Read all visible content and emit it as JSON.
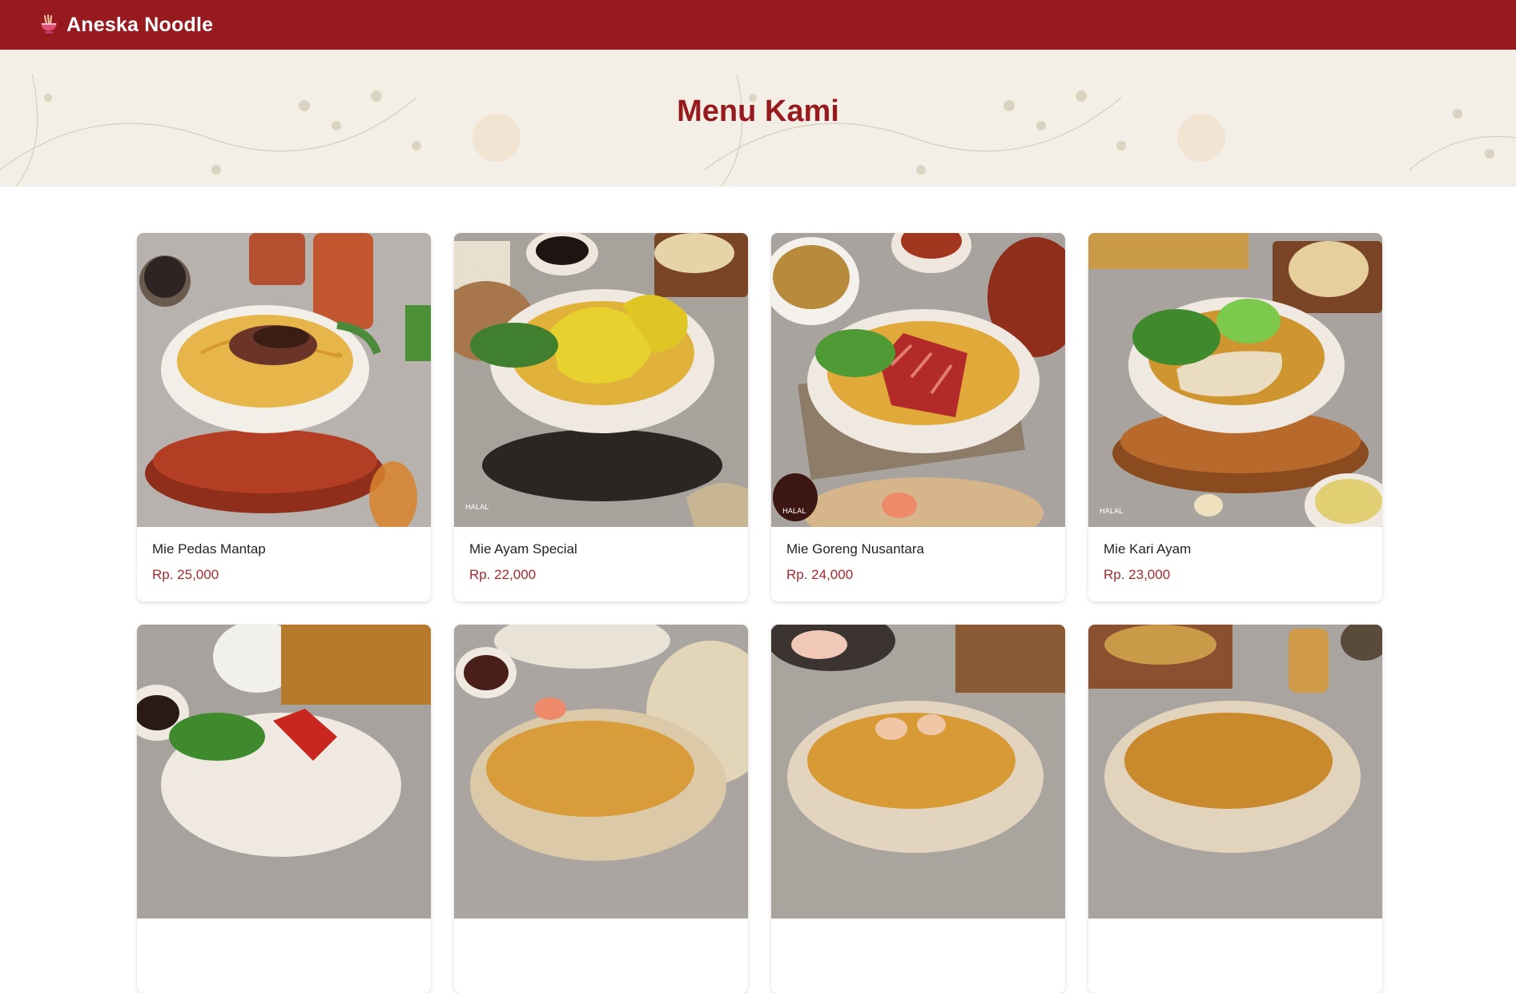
{
  "navbar": {
    "brand": "Aneska Noodle",
    "brand_icon": "noodle-bowl-icon",
    "background": "#971a1f"
  },
  "hero": {
    "title": "Menu Kami",
    "title_color": "#971a1f"
  },
  "menu": {
    "price_color": "#a52a2f",
    "items": [
      {
        "name": "Mie Pedas Mantap",
        "price": "Rp. 25,000"
      },
      {
        "name": "Mie Ayam Special",
        "price": "Rp. 22,000"
      },
      {
        "name": "Mie Goreng Nusantara",
        "price": "Rp. 24,000"
      },
      {
        "name": "Mie Kari Ayam",
        "price": "Rp. 23,000"
      },
      {
        "name": "",
        "price": ""
      },
      {
        "name": "",
        "price": ""
      },
      {
        "name": "",
        "price": ""
      },
      {
        "name": "",
        "price": ""
      }
    ]
  }
}
